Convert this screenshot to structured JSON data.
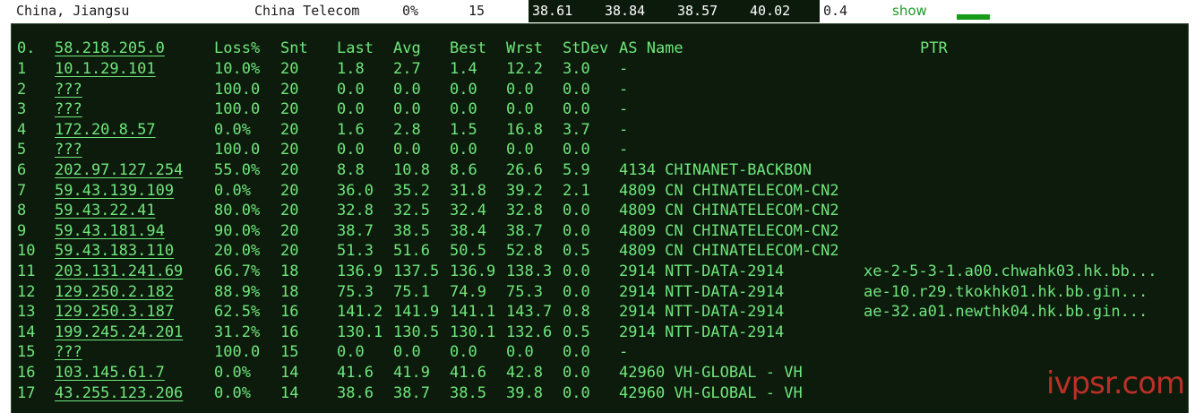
{
  "summary": {
    "location": "China, Jiangsu",
    "isp": "China Telecom",
    "loss": "0%",
    "sent": "15",
    "last": "38.61",
    "avg": "38.84",
    "best": "38.57",
    "worst": "40.02",
    "stdev": "0.4",
    "show_label": "show"
  },
  "table": {
    "headers": {
      "hop": "0.",
      "host": "58.218.205.0",
      "loss": "Loss%",
      "snt": "Snt",
      "last": "Last",
      "avg": "Avg",
      "best": "Best",
      "wrst": "Wrst",
      "stdev": "StDev",
      "as_name": "AS Name",
      "ptr": "PTR"
    },
    "rows": [
      {
        "hop": "1",
        "host": "10.1.29.101",
        "loss": "10.0%",
        "snt": "20",
        "last": "1.8",
        "avg": "2.7",
        "best": "1.4",
        "wrst": "12.2",
        "stdev": "3.0",
        "as": "-",
        "ptr": ""
      },
      {
        "hop": "2",
        "host": "???",
        "loss": "100.0",
        "snt": "20",
        "last": "0.0",
        "avg": "0.0",
        "best": "0.0",
        "wrst": "0.0",
        "stdev": "0.0",
        "as": "-",
        "ptr": ""
      },
      {
        "hop": "3",
        "host": "???",
        "loss": "100.0",
        "snt": "20",
        "last": "0.0",
        "avg": "0.0",
        "best": "0.0",
        "wrst": "0.0",
        "stdev": "0.0",
        "as": "-",
        "ptr": ""
      },
      {
        "hop": "4",
        "host": "172.20.8.57",
        "loss": "0.0%",
        "snt": "20",
        "last": "1.6",
        "avg": "2.8",
        "best": "1.5",
        "wrst": "16.8",
        "stdev": "3.7",
        "as": "-",
        "ptr": ""
      },
      {
        "hop": "5",
        "host": "???",
        "loss": "100.0",
        "snt": "20",
        "last": "0.0",
        "avg": "0.0",
        "best": "0.0",
        "wrst": "0.0",
        "stdev": "0.0",
        "as": "-",
        "ptr": ""
      },
      {
        "hop": "6",
        "host": "202.97.127.254",
        "loss": "55.0%",
        "snt": "20",
        "last": "8.8",
        "avg": "10.8",
        "best": "8.6",
        "wrst": "26.6",
        "stdev": "5.9",
        "as": "4134  CHINANET-BACKBON",
        "ptr": ""
      },
      {
        "hop": "7",
        "host": "59.43.139.109",
        "loss": "0.0%",
        "snt": "20",
        "last": "36.0",
        "avg": "35.2",
        "best": "31.8",
        "wrst": "39.2",
        "stdev": "2.1",
        "as": "4809  CN CHINATELECOM-CN2",
        "ptr": ""
      },
      {
        "hop": "8",
        "host": "59.43.22.41",
        "loss": "80.0%",
        "snt": "20",
        "last": "32.8",
        "avg": "32.5",
        "best": "32.4",
        "wrst": "32.8",
        "stdev": "0.0",
        "as": "4809  CN CHINATELECOM-CN2",
        "ptr": ""
      },
      {
        "hop": "9",
        "host": "59.43.181.94",
        "loss": "90.0%",
        "snt": "20",
        "last": "38.7",
        "avg": "38.5",
        "best": "38.4",
        "wrst": "38.7",
        "stdev": "0.0",
        "as": "4809  CN CHINATELECOM-CN2",
        "ptr": ""
      },
      {
        "hop": "10",
        "host": "59.43.183.110",
        "loss": "20.0%",
        "snt": "20",
        "last": "51.3",
        "avg": "51.6",
        "best": "50.5",
        "wrst": "52.8",
        "stdev": "0.5",
        "as": "4809  CN CHINATELECOM-CN2",
        "ptr": ""
      },
      {
        "hop": "11",
        "host": "203.131.241.69",
        "loss": "66.7%",
        "snt": "18",
        "last": "136.9",
        "avg": "137.5",
        "best": "136.9",
        "wrst": "138.3",
        "stdev": "0.0",
        "as": "2914  NTT-DATA-2914",
        "ptr": "xe-2-5-3-1.a00.chwahk03.hk.bb..."
      },
      {
        "hop": "12",
        "host": "129.250.2.182",
        "loss": "88.9%",
        "snt": "18",
        "last": "75.3",
        "avg": "75.1",
        "best": "74.9",
        "wrst": "75.3",
        "stdev": "0.0",
        "as": "2914  NTT-DATA-2914",
        "ptr": "ae-10.r29.tkokhk01.hk.bb.gin..."
      },
      {
        "hop": "13",
        "host": "129.250.3.187",
        "loss": "62.5%",
        "snt": "16",
        "last": "141.2",
        "avg": "141.9",
        "best": "141.1",
        "wrst": "143.7",
        "stdev": "0.8",
        "as": "2914  NTT-DATA-2914",
        "ptr": "ae-32.a01.newthk04.hk.bb.gin..."
      },
      {
        "hop": "14",
        "host": "199.245.24.201",
        "loss": "31.2%",
        "snt": "16",
        "last": "130.1",
        "avg": "130.5",
        "best": "130.1",
        "wrst": "132.6",
        "stdev": "0.5",
        "as": "2914  NTT-DATA-2914",
        "ptr": ""
      },
      {
        "hop": "15",
        "host": "???",
        "loss": "100.0",
        "snt": "15",
        "last": "0.0",
        "avg": "0.0",
        "best": "0.0",
        "wrst": "0.0",
        "stdev": "0.0",
        "as": "-",
        "ptr": ""
      },
      {
        "hop": "16",
        "host": "103.145.61.7",
        "loss": "0.0%",
        "snt": "14",
        "last": "41.6",
        "avg": "41.9",
        "best": "41.6",
        "wrst": "42.8",
        "stdev": "0.0",
        "as": "42960 VH-GLOBAL - VH",
        "ptr": ""
      },
      {
        "hop": "17",
        "host": "43.255.123.206",
        "loss": "0.0%",
        "snt": "14",
        "last": "38.6",
        "avg": "38.7",
        "best": "38.5",
        "wrst": "39.8",
        "stdev": "0.0",
        "as": "42960 VH-GLOBAL - VH",
        "ptr": ""
      }
    ]
  },
  "watermark": "ivpsr.com"
}
